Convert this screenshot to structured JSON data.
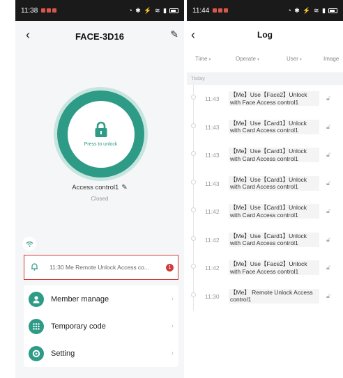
{
  "left": {
    "status": {
      "time": "11:38"
    },
    "header": {
      "title": "FACE-3D16"
    },
    "unlock": {
      "press_label": "Press to unlock"
    },
    "access": {
      "name": "Access control1",
      "status": "Closed"
    },
    "notice": {
      "text": "11:30 Me  Remote Unlock Access co...",
      "badge": "1"
    },
    "menu": [
      {
        "label": "Member manage",
        "icon": "person-icon"
      },
      {
        "label": "Temporary code",
        "icon": "grid-icon"
      },
      {
        "label": "Setting",
        "icon": "gear-icon"
      }
    ],
    "accent": "#2e9b87"
  },
  "right": {
    "status": {
      "time": "11:44"
    },
    "header": {
      "title": "Log"
    },
    "filters": [
      "Time",
      "Operate",
      "User",
      "Image"
    ],
    "section": "Today",
    "logs": [
      {
        "time": "11:43",
        "text": "【Me】Use【Face2】Unlock with Face Access control1"
      },
      {
        "time": "11:43",
        "text": "【Me】Use【Card1】Unlock with Card Access control1"
      },
      {
        "time": "11:43",
        "text": "【Me】Use【Card1】Unlock with Card Access control1"
      },
      {
        "time": "11:43",
        "text": "【Me】Use【Card1】Unlock with Card Access control1"
      },
      {
        "time": "11:42",
        "text": "【Me】Use【Card1】Unlock with Card Access control1"
      },
      {
        "time": "11:42",
        "text": "【Me】Use【Card1】Unlock with Card Access control1"
      },
      {
        "time": "11:42",
        "text": "【Me】Use【Face2】Unlock with Face Access control1"
      },
      {
        "time": "11:30",
        "text": "【Me】 Remote Unlock Access control1"
      }
    ]
  }
}
